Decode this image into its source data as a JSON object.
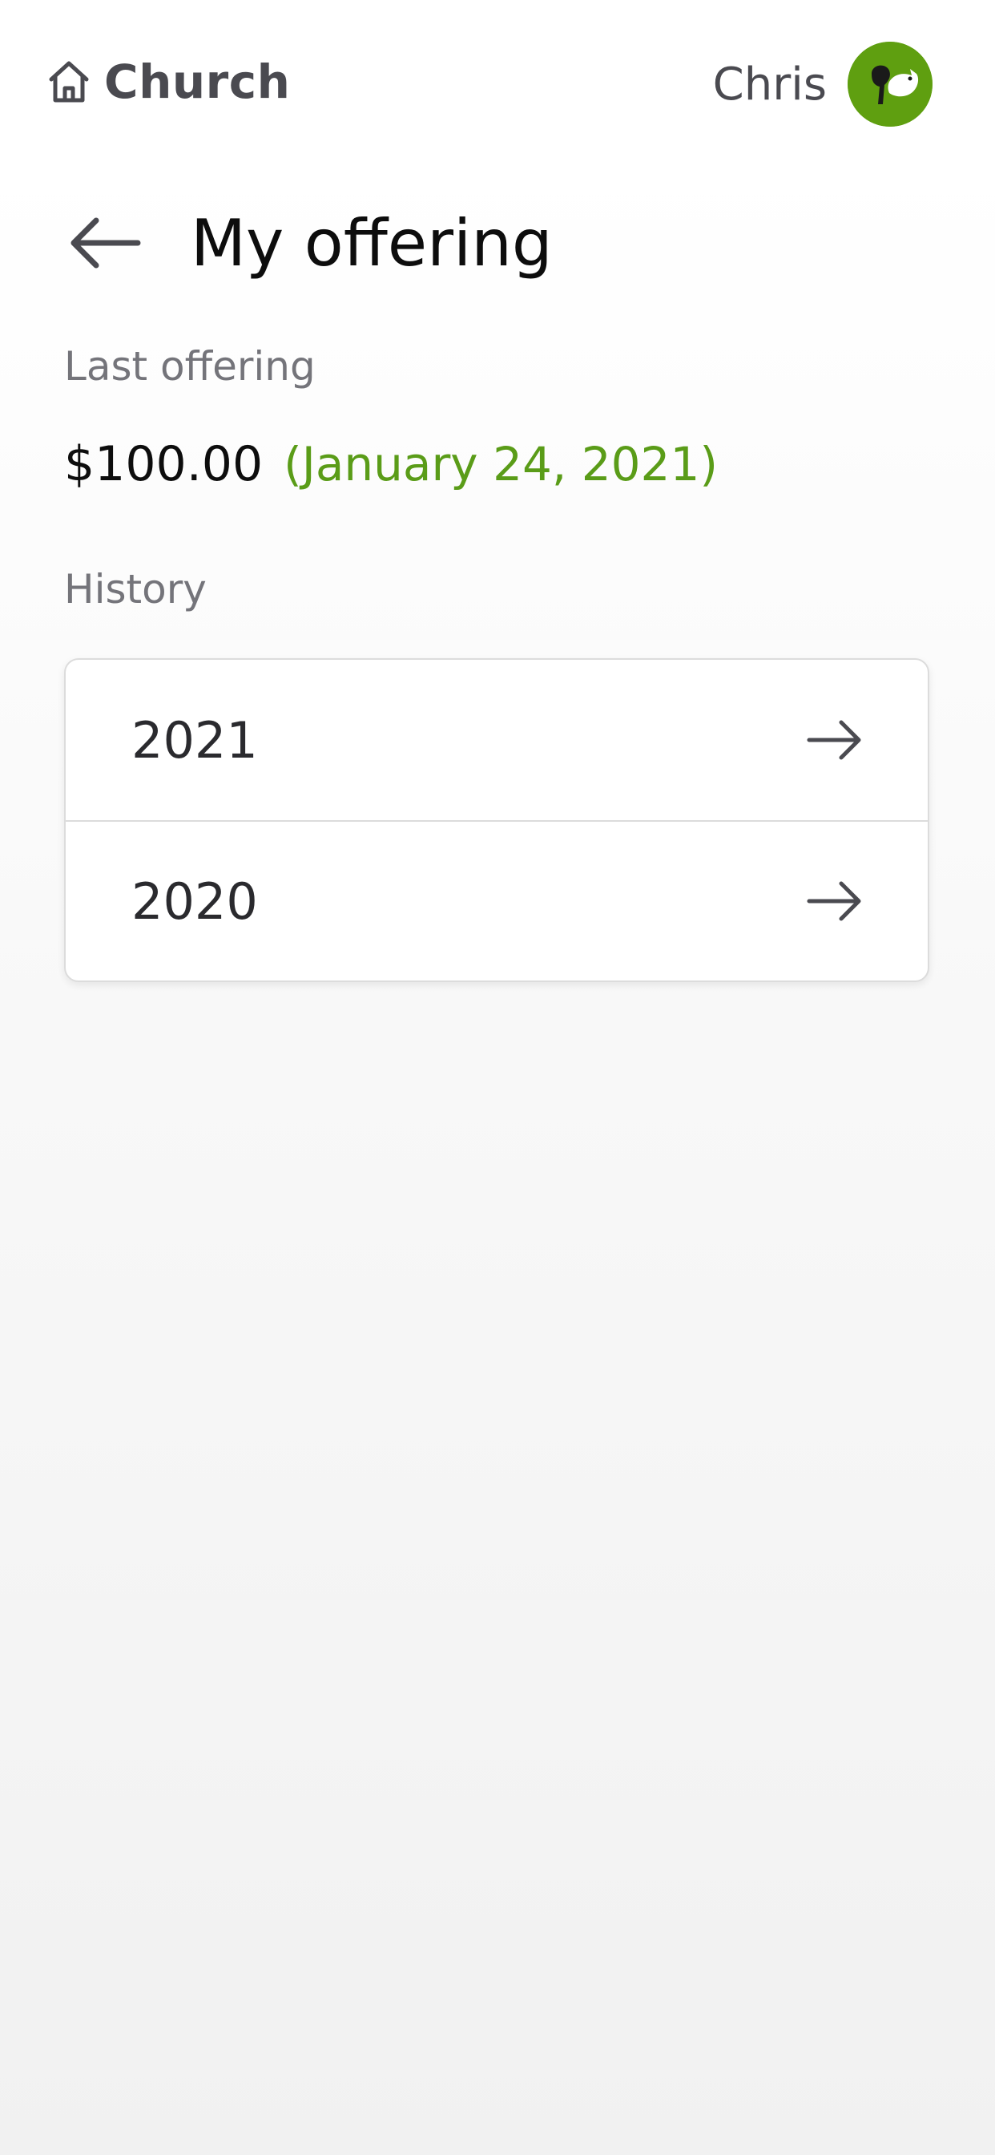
{
  "header": {
    "brand": "Church",
    "brand_icon": "home-icon",
    "user_name": "Chris",
    "avatar_color": "#5f9f10"
  },
  "page": {
    "title": "My offering",
    "back_icon": "arrow-left-icon"
  },
  "last_offering": {
    "label": "Last offering",
    "amount": "$100.00",
    "date": "(January 24, 2021)",
    "date_color": "#5a9c18"
  },
  "history": {
    "label": "History",
    "items": [
      {
        "year": "2021",
        "icon": "arrow-right-icon"
      },
      {
        "year": "2020",
        "icon": "arrow-right-icon"
      }
    ]
  }
}
